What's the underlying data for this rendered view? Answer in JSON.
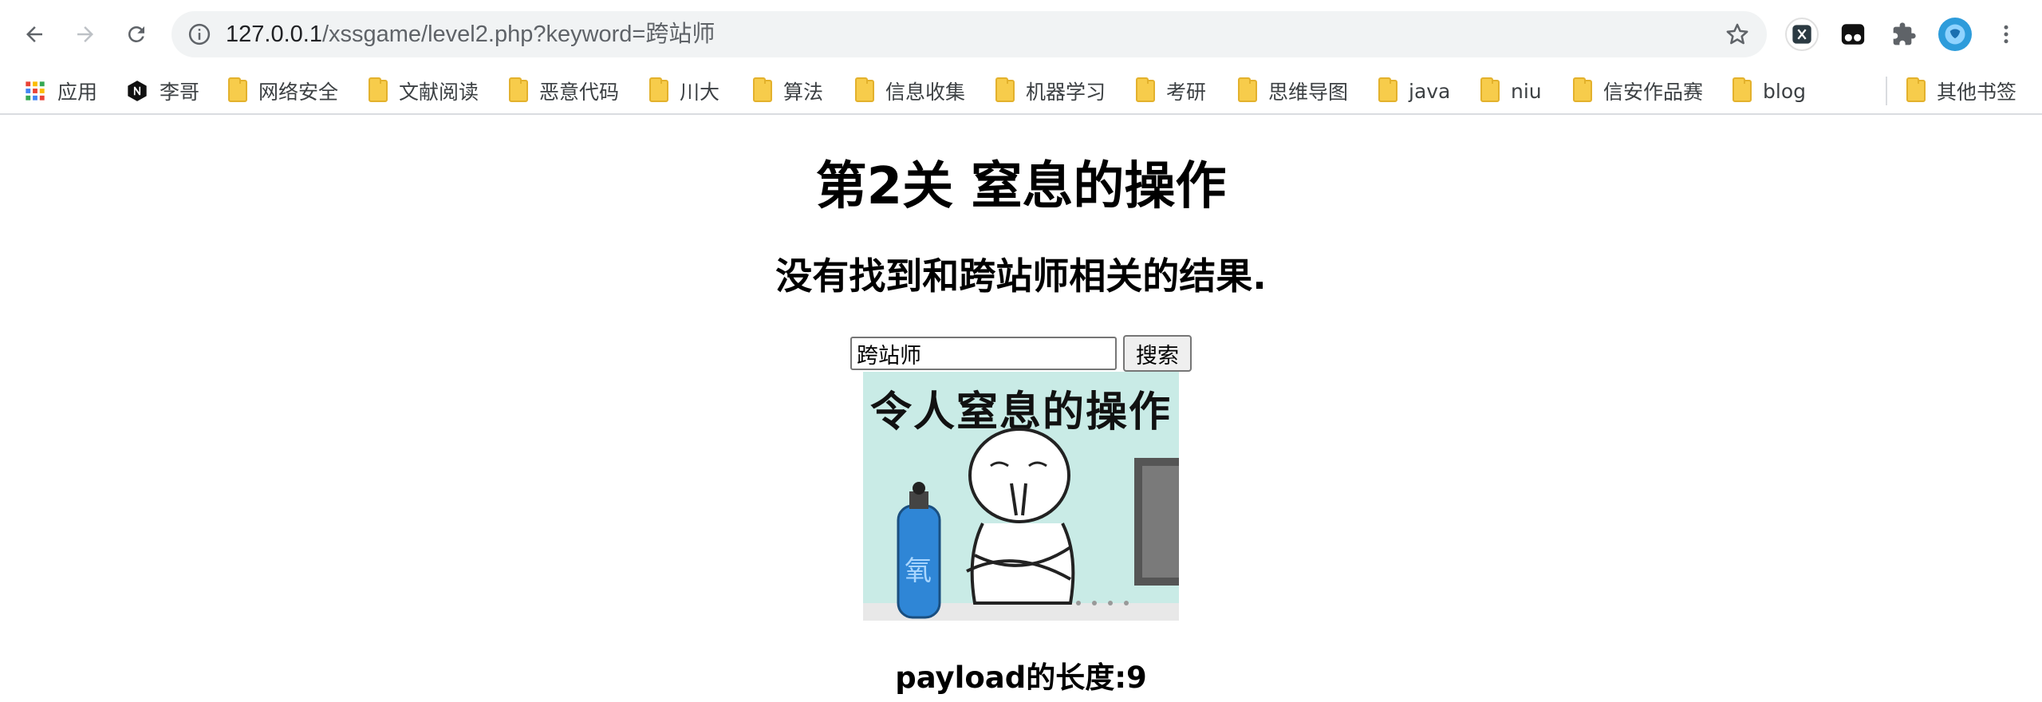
{
  "browser": {
    "url_host": "127.0.0.1",
    "url_path": "/xssgame/level2.php?keyword=跨站师"
  },
  "bookmarks": [
    {
      "label": "应用",
      "icon": "apps-grid-icon"
    },
    {
      "label": "李哥",
      "icon": "n-logo-icon"
    },
    {
      "label": "网络安全",
      "icon": "folder-icon"
    },
    {
      "label": "文献阅读",
      "icon": "folder-icon"
    },
    {
      "label": "恶意代码",
      "icon": "folder-icon"
    },
    {
      "label": "川大",
      "icon": "folder-icon"
    },
    {
      "label": "算法",
      "icon": "folder-icon"
    },
    {
      "label": "信息收集",
      "icon": "folder-icon"
    },
    {
      "label": "机器学习",
      "icon": "folder-icon"
    },
    {
      "label": "考研",
      "icon": "folder-icon"
    },
    {
      "label": "思维导图",
      "icon": "folder-icon"
    },
    {
      "label": "java",
      "icon": "folder-icon"
    },
    {
      "label": "niu",
      "icon": "folder-icon"
    },
    {
      "label": "信安作品赛",
      "icon": "folder-icon"
    },
    {
      "label": "blog",
      "icon": "folder-icon"
    }
  ],
  "other_bookmarks": "其他书签",
  "page": {
    "title": "第2关 窒息的操作",
    "result_text": "没有找到和跨站师相关的结果.",
    "search_value": "跨站师",
    "search_button": "搜索",
    "image_caption": "令人窒息的操作",
    "image_label": "氧",
    "payload_length": "payload的长度:9"
  },
  "colors": {
    "folder": "#f7cc4b",
    "omnibox": "#f1f3f4",
    "ext_avatar": "#2d9cdb"
  }
}
